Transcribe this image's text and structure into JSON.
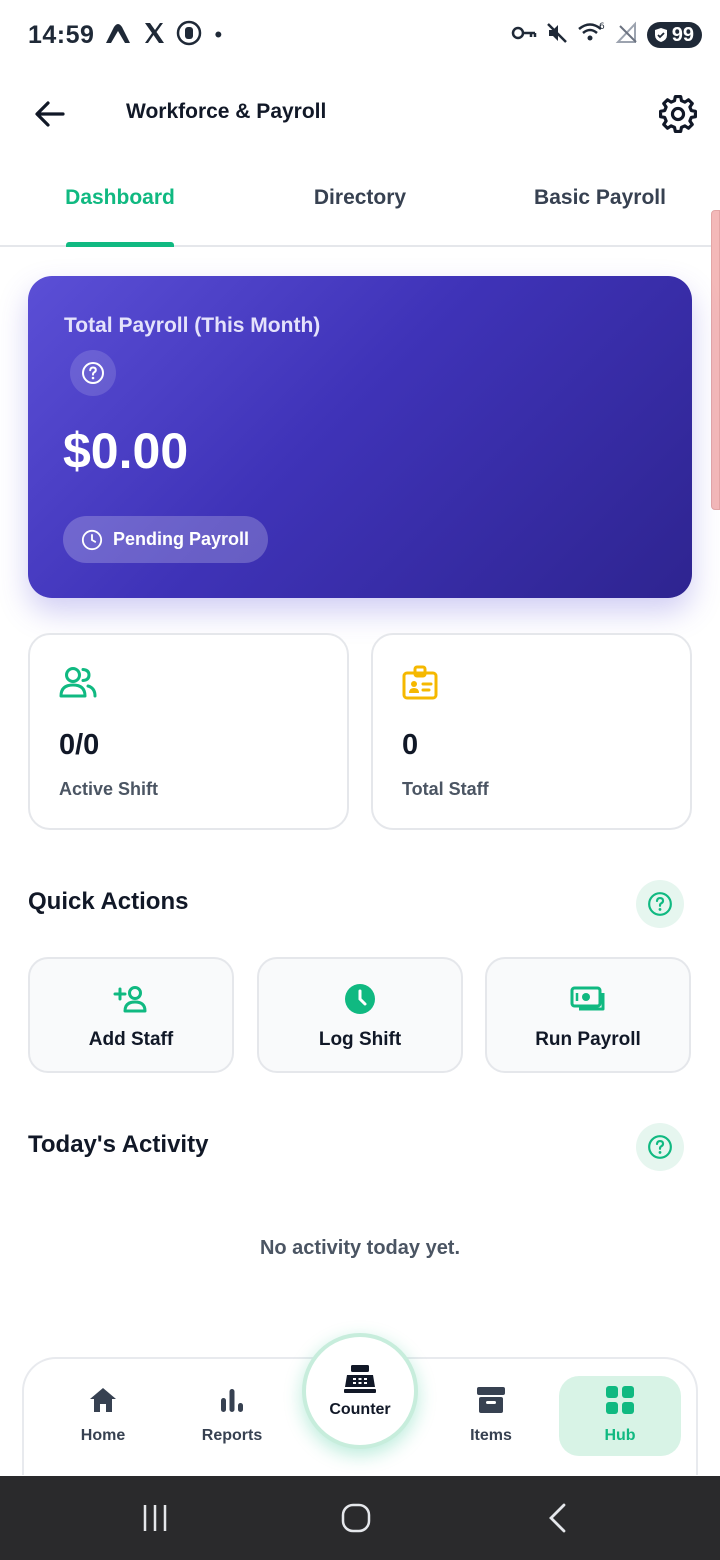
{
  "status_bar": {
    "time": "14:59",
    "battery": "99",
    "dot": "•",
    "icons": [
      "mountain-app-icon",
      "x-app-icon",
      "recorder-icon",
      "key-icon",
      "mute-icon",
      "wifi-icon",
      "no-signal-icon",
      "battery-icon"
    ]
  },
  "header": {
    "title": "Workforce & Payroll",
    "back_icon": "arrow-left-icon",
    "settings_icon": "gear-icon"
  },
  "tabs": [
    {
      "label": "Dashboard",
      "active": true
    },
    {
      "label": "Directory",
      "active": false
    },
    {
      "label": "Basic Payroll",
      "active": false
    }
  ],
  "payroll_card": {
    "label": "Total Payroll (This Month)",
    "amount": "$0.00",
    "status": "Pending Payroll",
    "help_icon": "help-circle-icon",
    "status_icon": "clock-icon"
  },
  "stats": [
    {
      "value": "0/0",
      "label": "Active Shift",
      "icon": "users-icon",
      "color": "#10b981"
    },
    {
      "value": "0",
      "label": "Total Staff",
      "icon": "id-badge-icon",
      "color": "#f5b800"
    }
  ],
  "quick_actions": {
    "title": "Quick Actions",
    "items": [
      {
        "label": "Add Staff",
        "icon": "user-plus-icon"
      },
      {
        "label": "Log Shift",
        "icon": "clock-filled-icon"
      },
      {
        "label": "Run Payroll",
        "icon": "banknote-icon"
      }
    ]
  },
  "activity": {
    "title": "Today's Activity",
    "empty_message": "No activity today yet."
  },
  "bottom_nav": {
    "items": [
      {
        "label": "Home",
        "icon": "home-icon",
        "active": false
      },
      {
        "label": "Reports",
        "icon": "bar-chart-icon",
        "active": false
      },
      {
        "label": "Counter",
        "icon": "cash-register-icon",
        "active": false
      },
      {
        "label": "Items",
        "icon": "archive-box-icon",
        "active": false
      },
      {
        "label": "Hub",
        "icon": "grid-icon",
        "active": true
      }
    ]
  },
  "colors": {
    "accent": "#10b981",
    "hero_start": "#5b4fd6",
    "hero_end": "#2e2490",
    "staff_icon": "#f5b800"
  }
}
